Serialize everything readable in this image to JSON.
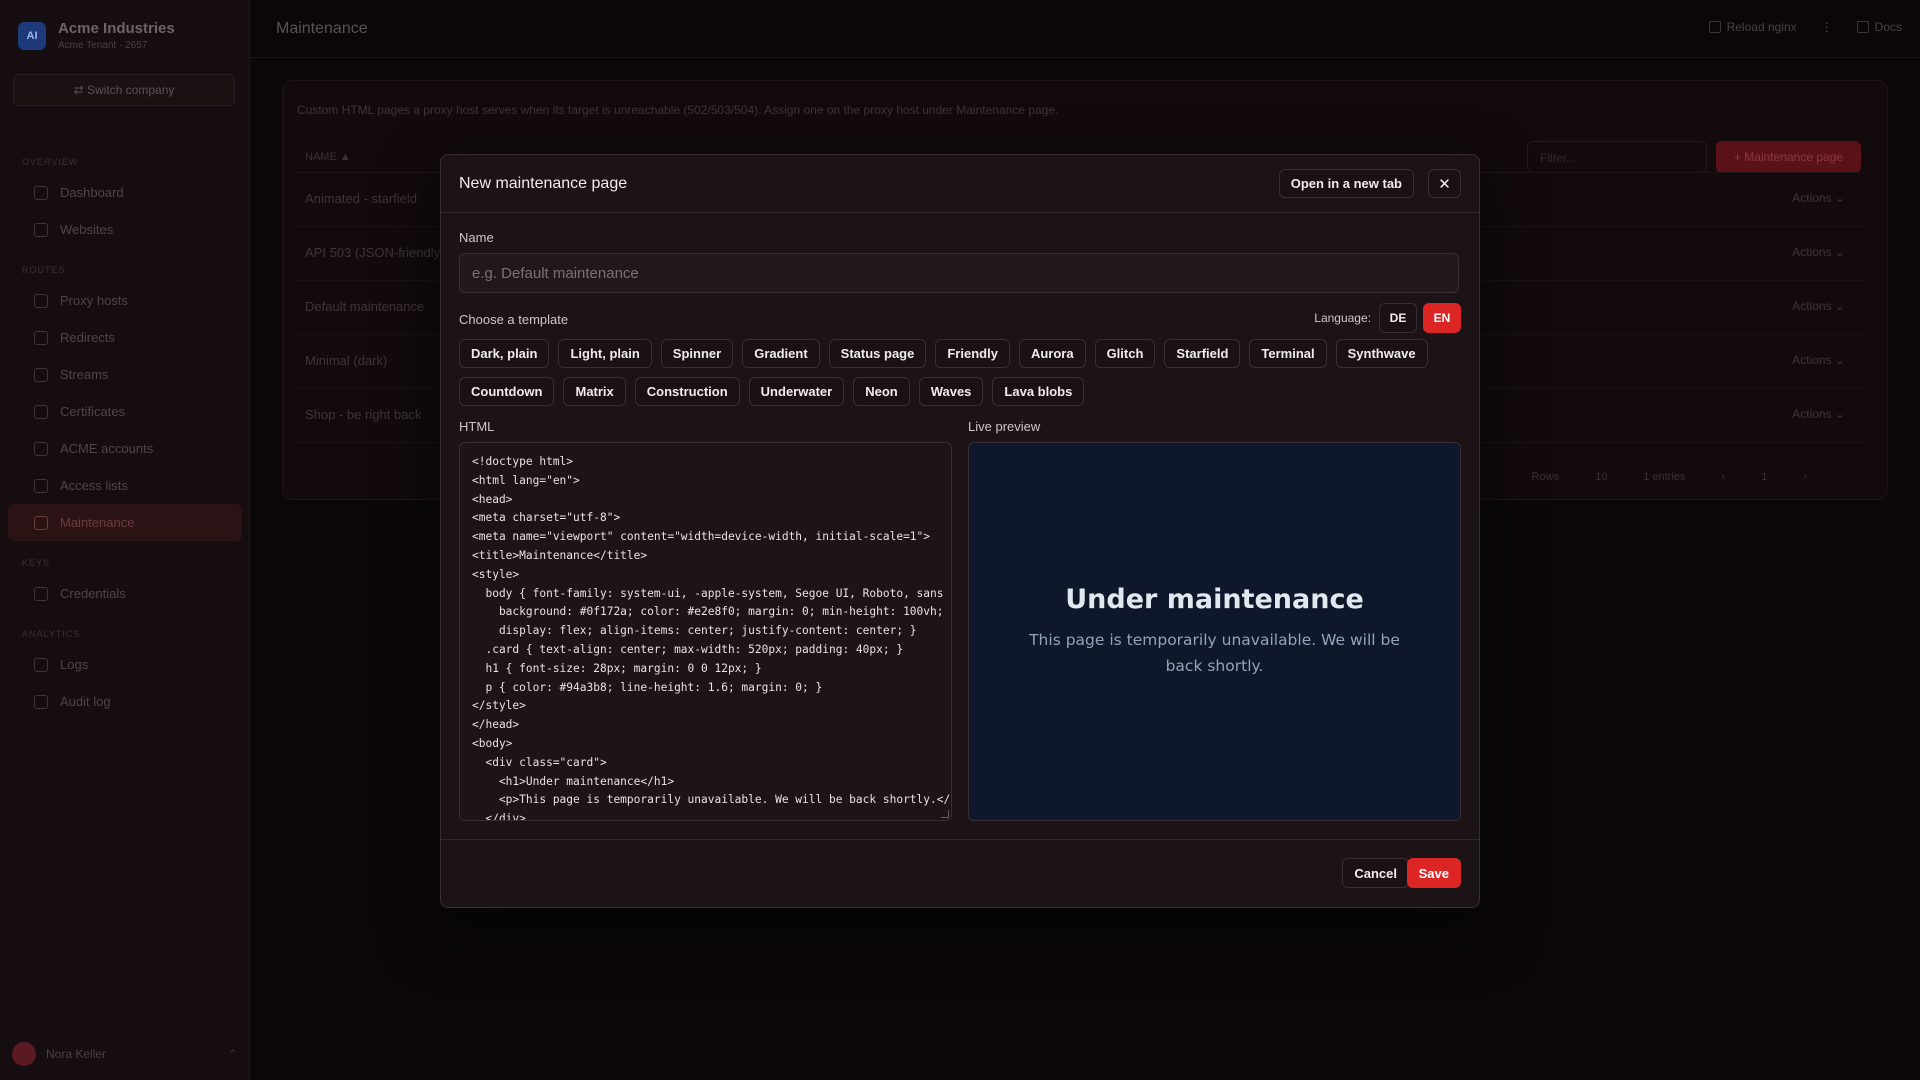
{
  "app": {
    "company": "Acme Industries",
    "company_sub": "Acme Tenant · 2657",
    "switch_label": "⇄ Switch company",
    "page_title": "Maintenance",
    "top_actions": [
      "Reload nginx",
      "⋮",
      "Docs"
    ],
    "nav": [
      {
        "section": "OVERVIEW",
        "items": [
          "Dashboard",
          "Websites"
        ]
      },
      {
        "section": "ROUTES",
        "items": [
          "Proxy hosts",
          "Redirects",
          "Streams",
          "Certificates",
          "ACME accounts",
          "Access lists",
          "Maintenance"
        ]
      },
      {
        "section": "KEYS",
        "items": [
          "Credentials"
        ]
      },
      {
        "section": "ANALYTICS",
        "items": [
          "Logs",
          "Audit log"
        ]
      }
    ],
    "user_name": "Nora Keller",
    "main_desc": "Custom HTML pages a proxy host serves when its target is unreachable (502/503/504). Assign one on the proxy host under Maintenance page.",
    "filter_placeholder": "Filter...",
    "add_button": "+ Maintenance page",
    "table_header": "NAME ▲",
    "rows": [
      "Animated - starfield",
      "API 503 (JSON-friendly)",
      "Default maintenance",
      "Minimal (dark)",
      "Shop - be right back"
    ],
    "row_action": "Actions ⌄",
    "pager": [
      "Rows",
      "10",
      "1 entries",
      "‹",
      "1",
      "›"
    ]
  },
  "modal": {
    "title": "New maintenance page",
    "open_tab_label": "Open in a new tab",
    "close_icon": "✕",
    "name_label": "Name",
    "name_value": "",
    "name_placeholder": "e.g. Default maintenance",
    "template_label": "Choose a template",
    "language_label": "Language:",
    "languages": [
      "DE",
      "EN"
    ],
    "selected_language": "EN",
    "templates": [
      "Dark, plain",
      "Light, plain",
      "Spinner",
      "Gradient",
      "Status page",
      "Friendly",
      "Aurora",
      "Glitch",
      "Starfield",
      "Terminal",
      "Synthwave",
      "Countdown",
      "Matrix",
      "Construction",
      "Underwater",
      "Neon",
      "Waves",
      "Lava blobs"
    ],
    "html_label": "HTML",
    "html_code": "<!doctype html>\n<html lang=\"en\">\n<head>\n<meta charset=\"utf-8\">\n<meta name=\"viewport\" content=\"width=device-width, initial-scale=1\">\n<title>Maintenance</title>\n<style>\n  body { font-family: system-ui, -apple-system, Segoe UI, Roboto, sans\n    background: #0f172a; color: #e2e8f0; margin: 0; min-height: 100vh;\n    display: flex; align-items: center; justify-content: center; }\n  .card { text-align: center; max-width: 520px; padding: 40px; }\n  h1 { font-size: 28px; margin: 0 0 12px; }\n  p { color: #94a3b8; line-height: 1.6; margin: 0; }\n</style>\n</head>\n<body>\n  <div class=\"card\">\n    <h1>Under maintenance</h1>\n    <p>This page is temporarily unavailable. We will be back shortly.</p>\n  </div>",
    "preview_label": "Live preview",
    "preview_title": "Under maintenance",
    "preview_text": "This page is temporarily unavailable. We will be back shortly.",
    "cancel_label": "Cancel",
    "save_label": "Save"
  },
  "colors": {
    "accent": "#dc2626",
    "preview_bg": "#0f172a",
    "preview_title": "#e2e8f0",
    "preview_text": "#94a3b8"
  }
}
